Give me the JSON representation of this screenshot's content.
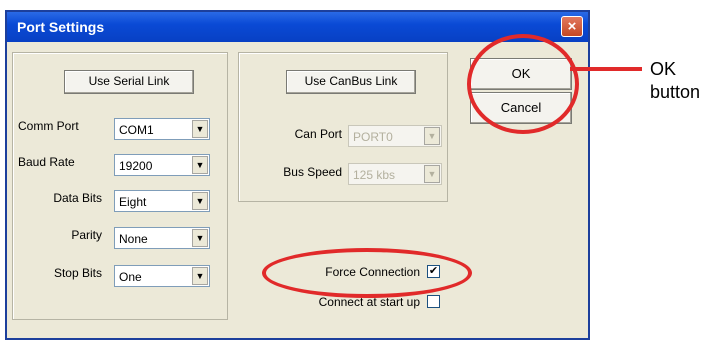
{
  "dialog": {
    "title": "Port Settings",
    "close_glyph": "×"
  },
  "serial": {
    "button_label": "Use Serial Link",
    "fields": [
      {
        "label": "Comm Port",
        "value": "COM1"
      },
      {
        "label": "Baud Rate",
        "value": "19200"
      },
      {
        "label": "Data Bits",
        "value": "Eight"
      },
      {
        "label": "Parity",
        "value": "None"
      },
      {
        "label": "Stop Bits",
        "value": "One"
      }
    ]
  },
  "canbus": {
    "button_label": "Use CanBus Link",
    "fields": [
      {
        "label": "Can Port",
        "value": "PORT0",
        "enabled": false
      },
      {
        "label": "Bus Speed",
        "value": "125 kbs",
        "enabled": false
      }
    ]
  },
  "options": {
    "force_connection": {
      "label": "Force Connection",
      "checked": true
    },
    "connect_at_startup": {
      "label": "Connect at start up",
      "checked": false
    }
  },
  "actions": {
    "ok_label": "OK",
    "cancel_label": "Cancel"
  },
  "annotation": {
    "callout_line1": "OK",
    "callout_line2": "button",
    "color": "#e12a2a"
  },
  "glyphs": {
    "dropdown": "▼",
    "check": "✔"
  }
}
